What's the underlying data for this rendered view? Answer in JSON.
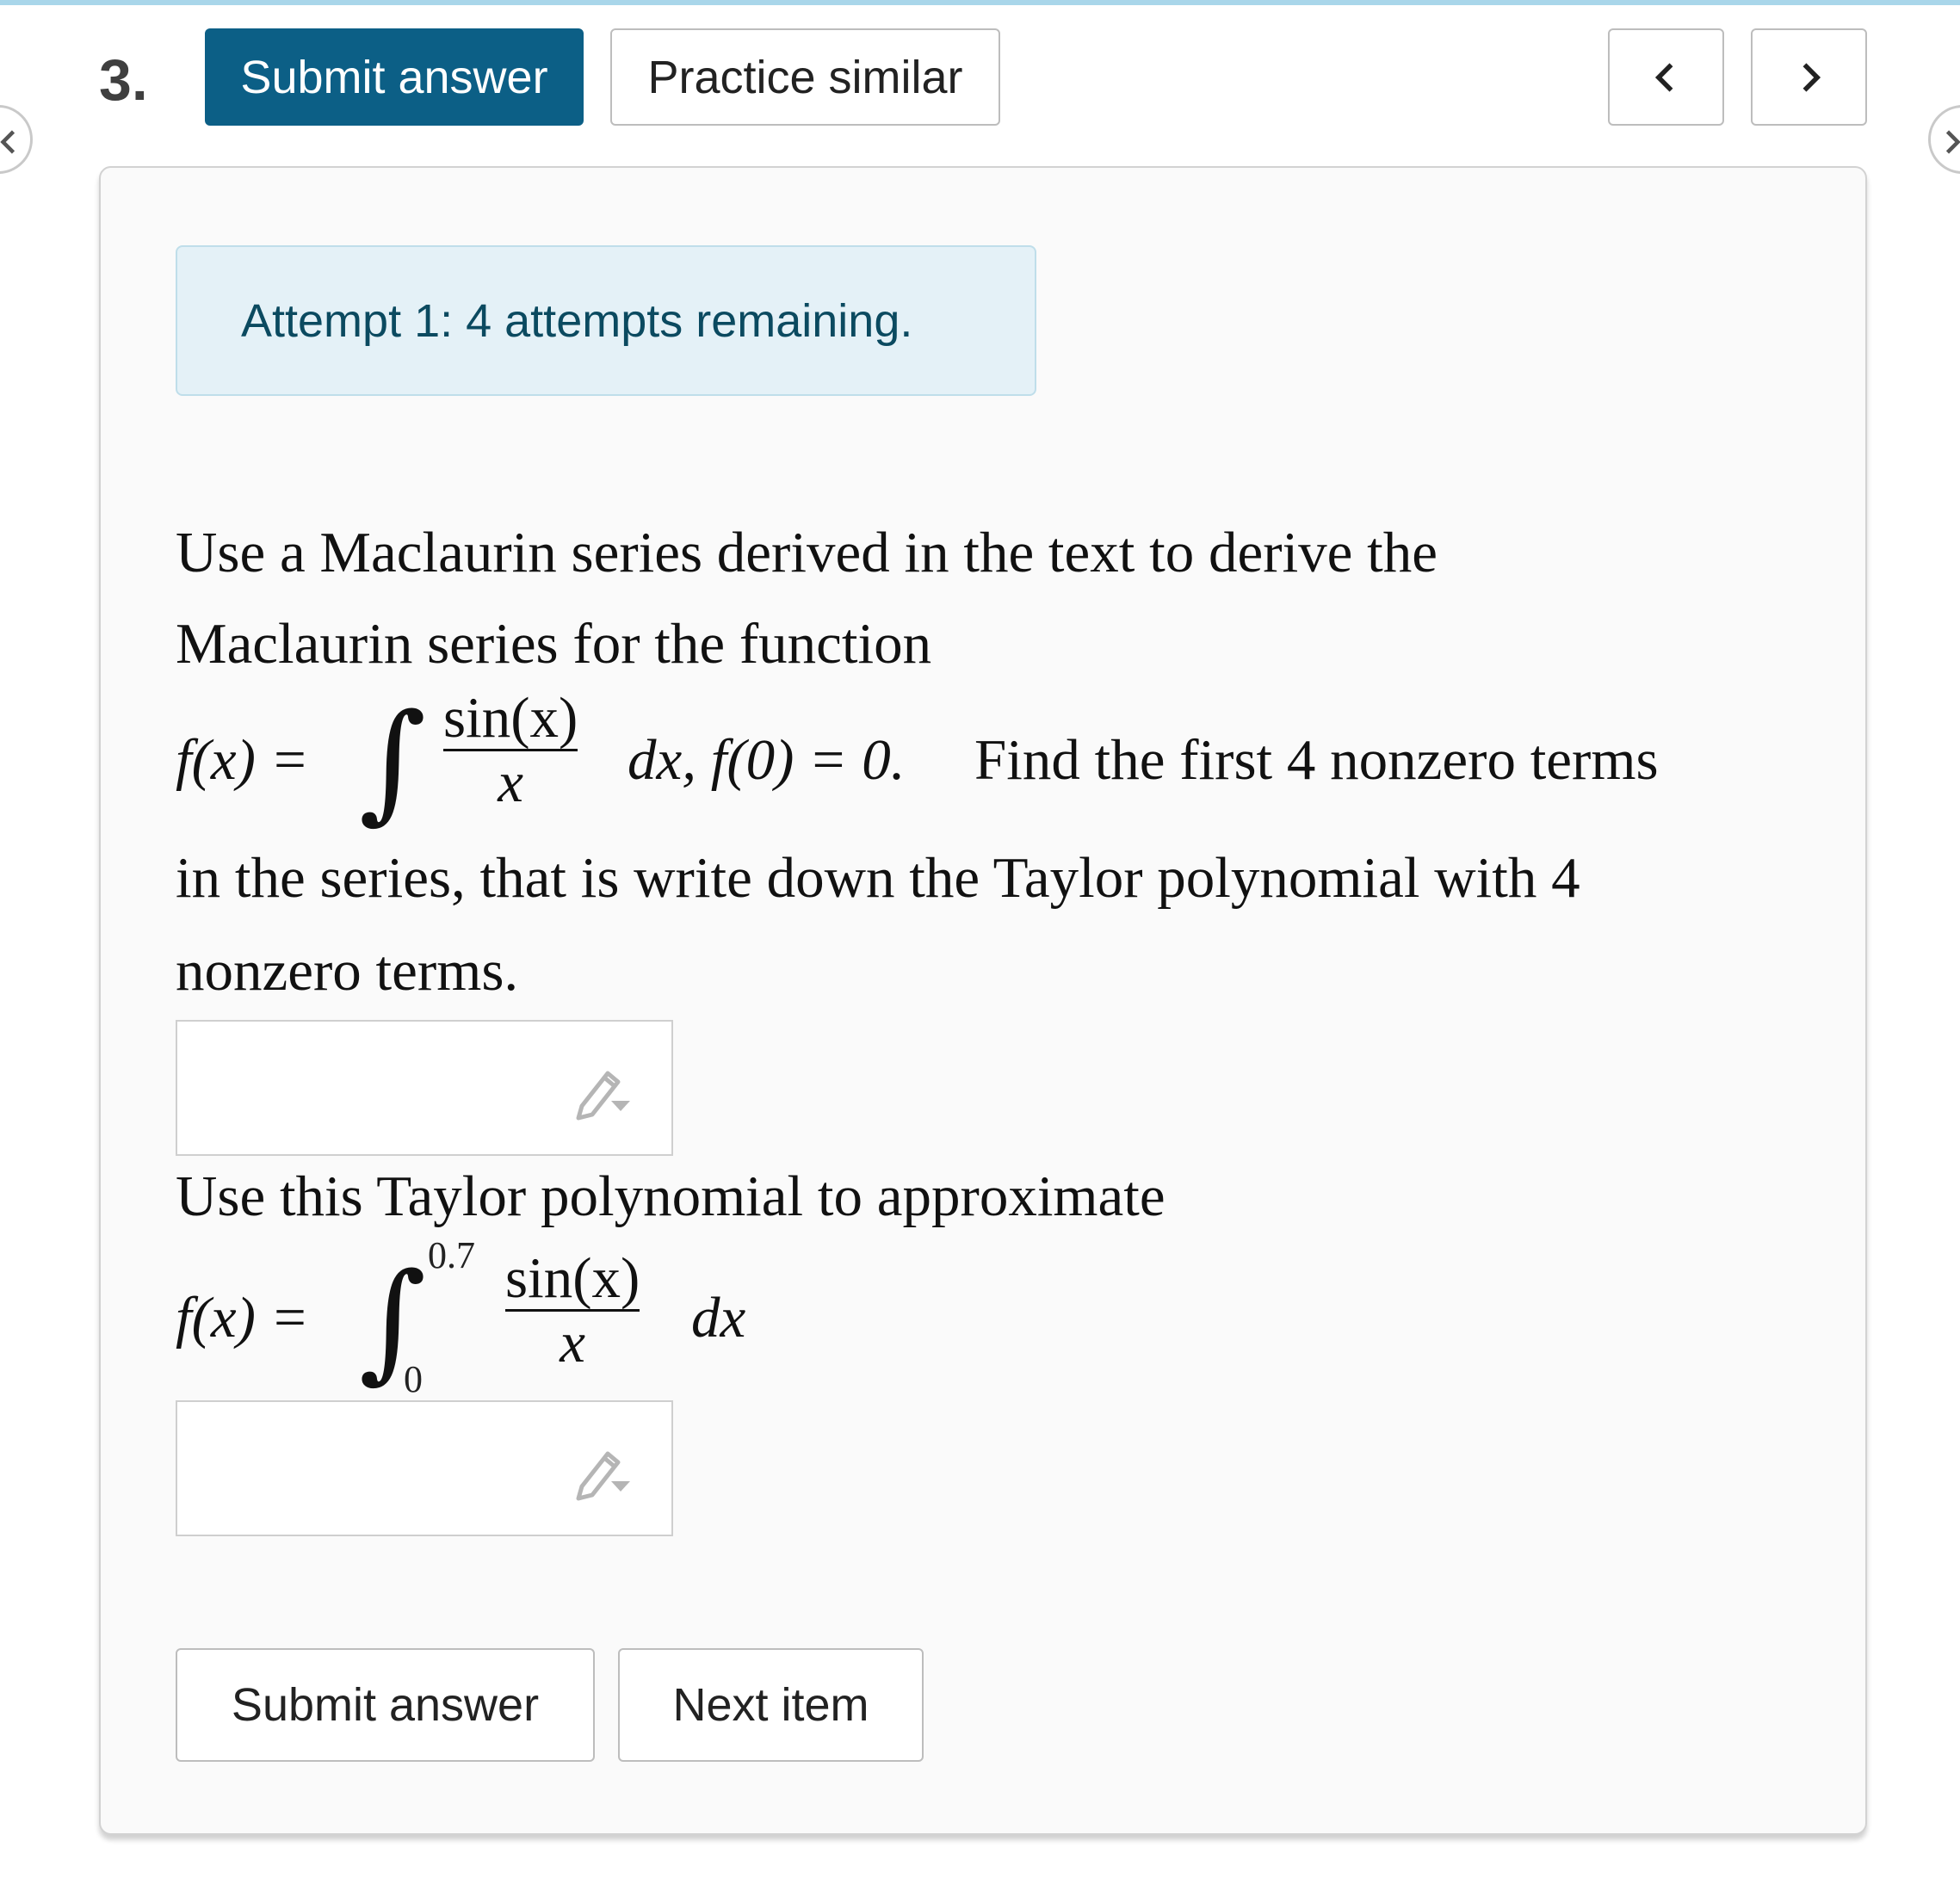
{
  "question": {
    "number": "3."
  },
  "toolbar": {
    "submit_label": "Submit answer",
    "practice_label": "Practice similar",
    "prev_icon": "chevron-left-icon",
    "next_icon": "chevron-right-icon"
  },
  "attempt_banner": "Attempt 1: 4 attempts remaining.",
  "problem": {
    "line1": "Use a Maclaurin series derived in the text to derive the",
    "line2": "Maclaurin series for the function",
    "eq1_lhs": "f(x) =",
    "eq1_num": "sin(x)",
    "eq1_den": "x",
    "eq1_tail_a": "dx, f(0) = 0.",
    "eq1_tail_b": "Find the first 4 nonzero terms",
    "line4": "in the series, that is write down the Taylor polynomial with 4",
    "line5": "nonzero terms.",
    "line6": "Use this Taylor polynomial to approximate",
    "eq2_lhs": "f(x) =",
    "eq2_upper": "0.7",
    "eq2_lower": "0",
    "eq2_num": "sin(x)",
    "eq2_den": "x",
    "eq2_tail": "dx"
  },
  "answer_fields": [
    {
      "value": "",
      "icon": "pencil-dropdown-icon"
    },
    {
      "value": "",
      "icon": "pencil-dropdown-icon"
    }
  ],
  "footer": {
    "submit_label": "Submit answer",
    "next_label": "Next item"
  },
  "colors": {
    "primary": "#0c5f86",
    "banner_bg": "#e4f1f7",
    "banner_text": "#0b4a60"
  }
}
